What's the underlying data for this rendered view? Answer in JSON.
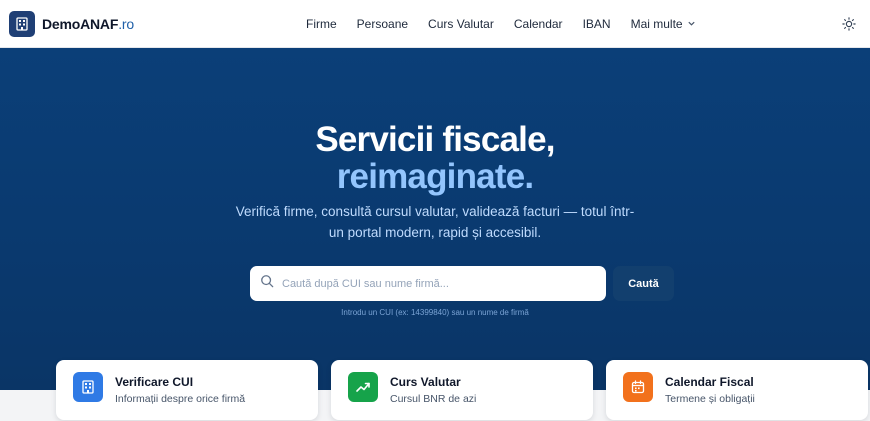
{
  "header": {
    "brand_name": "DemoANAF",
    "brand_tld": ".ro",
    "nav": [
      {
        "label": "Firme"
      },
      {
        "label": "Persoane"
      },
      {
        "label": "Curs Valutar"
      },
      {
        "label": "Calendar"
      },
      {
        "label": "IBAN"
      },
      {
        "label": "Mai multe"
      }
    ],
    "theme_icon": "sun-icon"
  },
  "hero": {
    "title_line1": "Servicii fiscale,",
    "title_line2": "reimaginate.",
    "subtitle": "Verifică firme, consultă cursul valutar, validează facturi — totul într-un portal modern, rapid și accesibil.",
    "search_placeholder": "Caută după CUI sau nume firmă...",
    "search_button": "Caută",
    "hint": "Introdu un CUI (ex: 14399840) sau un nume de firmă"
  },
  "cards": [
    {
      "title": "Verificare CUI",
      "description": "Informații despre orice firmă",
      "icon": "building-icon",
      "color": "#2f7ae5"
    },
    {
      "title": "Curs Valutar",
      "description": "Cursul BNR de azi",
      "icon": "trending-up-icon",
      "color": "#16a34a"
    },
    {
      "title": "Calendar Fiscal",
      "description": "Termene și obligații",
      "icon": "calendar-icon",
      "color": "#f2711c"
    }
  ],
  "colors": {
    "brand": "#1f3f75",
    "hero_bg": "#0b3f78",
    "accent_text": "#93c5fd"
  }
}
